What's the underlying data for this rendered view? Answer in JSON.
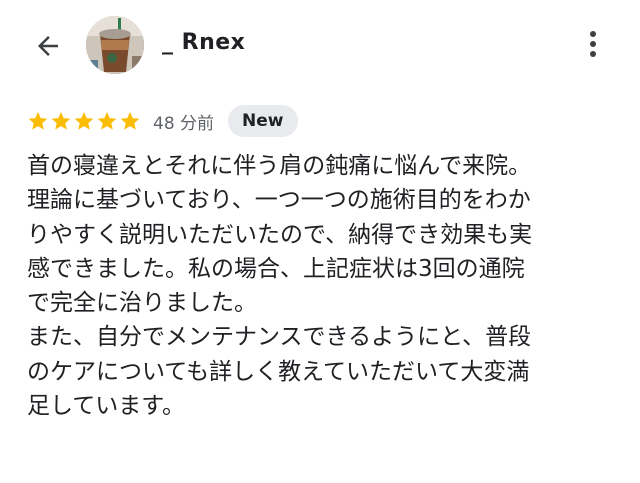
{
  "header": {
    "back_icon": "arrow-left-icon",
    "user_name": "_ Rnex",
    "more_icon": "more-vert-icon"
  },
  "review": {
    "rating": 5,
    "rating_max": 5,
    "star_color": "#fbbc04",
    "time_ago": "48 分前",
    "badge": "New",
    "text_lines": [
      "首の寝違えとそれに伴う肩の鈍痛に悩んで来院。",
      "理論に基づいており、一つ一つの施術目的をわか",
      "りやすく説明いただいたので、納得でき効果も実",
      "感できました。私の場合、上記症状は3回の通院",
      "で完全に治りました。",
      "また、自分でメンテナンスできるようにと、普段",
      "のケアについても詳しく教えていただいて大変満",
      "足しています。"
    ]
  }
}
